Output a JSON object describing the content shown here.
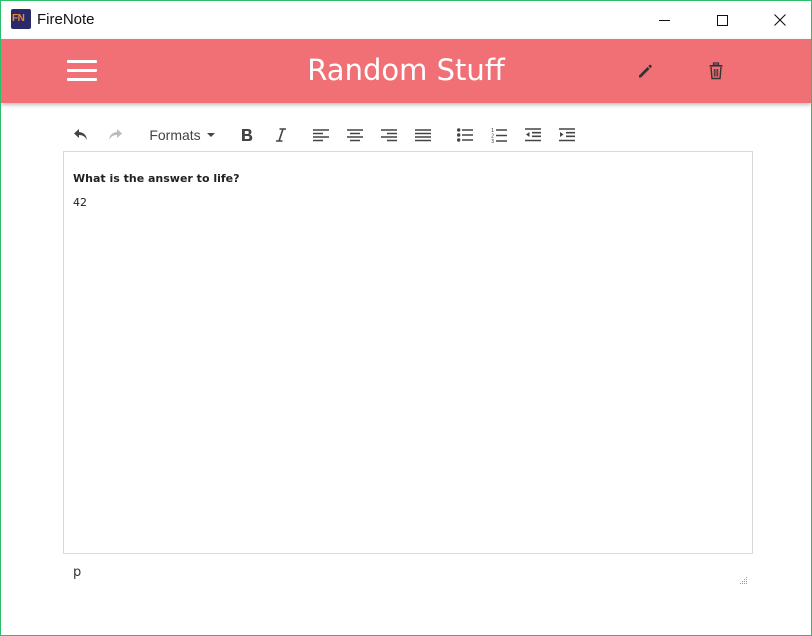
{
  "window": {
    "app_name": "FireNote",
    "app_icon_text": "FN"
  },
  "header": {
    "note_title": "Random Stuff",
    "accent_color": "#f07076"
  },
  "toolbar": {
    "formats_label": "Formats",
    "buttons": [
      "undo",
      "redo",
      "formats",
      "bold",
      "italic",
      "align-left",
      "align-center",
      "align-right",
      "align-justify",
      "bullet-list",
      "numbered-list",
      "outdent",
      "indent"
    ]
  },
  "editor": {
    "question": "What is the answer to life?",
    "answer": "42"
  },
  "statusbar": {
    "path": "p"
  }
}
